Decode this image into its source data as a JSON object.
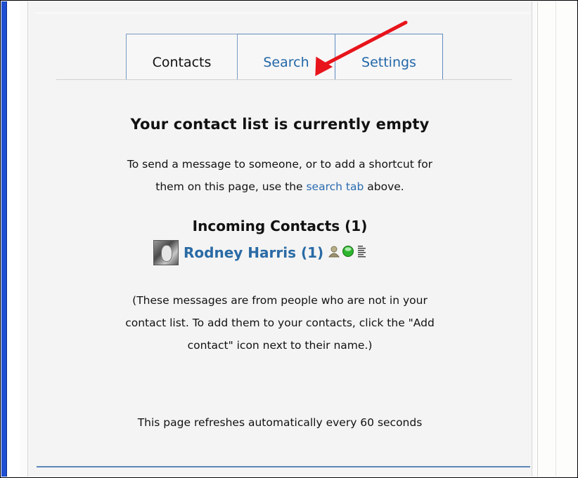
{
  "tabs": {
    "contacts": "Contacts",
    "search": "Search",
    "settings": "Settings"
  },
  "main": {
    "heading": "Your contact list is currently empty",
    "intro_line1": "To send a message to someone, or to add a shortcut for",
    "intro_line2_before": "them on this page, use the ",
    "intro_link": "search tab",
    "intro_line2_after": " above."
  },
  "incoming": {
    "title": "Incoming Contacts (1)",
    "contact_name": "Rodney Harris (1)",
    "icons": [
      "person-icon",
      "online-status-icon",
      "message-list-icon"
    ],
    "note_line1": "(These messages are from people who are not in your",
    "note_line2": "contact list. To add them to your contacts, click the \"Add",
    "note_line3": "contact\" icon next to their name.)"
  },
  "footer": {
    "refresh_text": "This page refreshes automatically every 60 seconds"
  },
  "colors": {
    "link": "#2a6bb0",
    "tab_border": "#5d8ac0",
    "arrow": "#e8141b",
    "left_strip": "#1f4fd0"
  }
}
